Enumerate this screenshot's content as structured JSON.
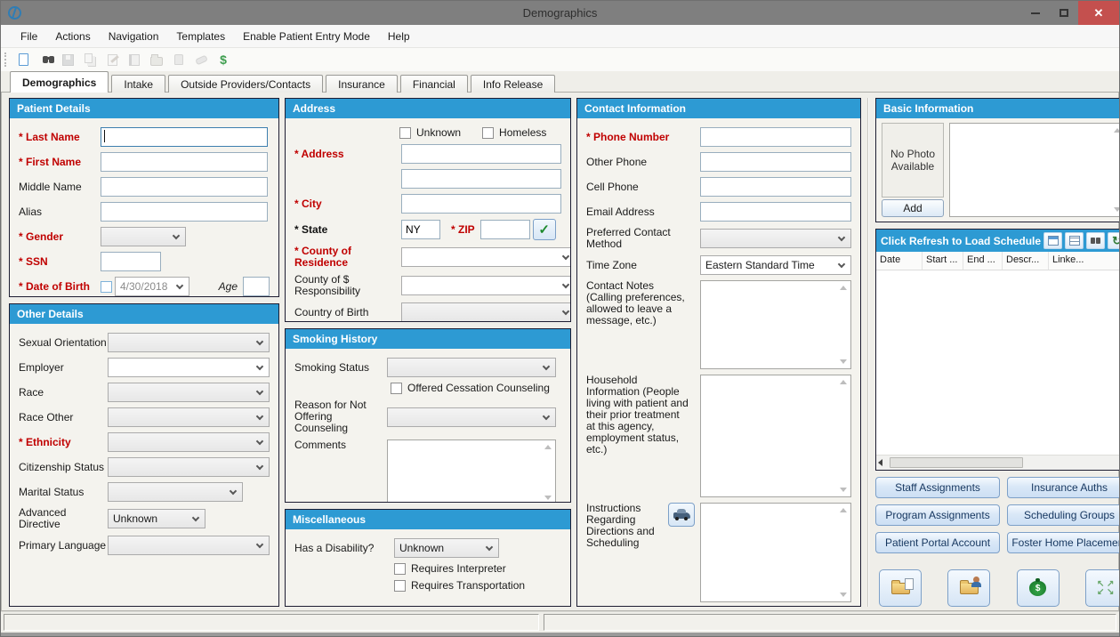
{
  "window": {
    "title": "Demographics"
  },
  "menu": {
    "items": [
      "File",
      "Actions",
      "Navigation",
      "Templates",
      "Enable Patient Entry Mode",
      "Help"
    ]
  },
  "toolbar": {
    "icons": [
      {
        "name": "new-document",
        "enabled": true
      },
      {
        "name": "find-binoculars",
        "enabled": true
      },
      {
        "name": "save",
        "enabled": false
      },
      {
        "name": "copy",
        "enabled": false
      },
      {
        "name": "edit",
        "enabled": false
      },
      {
        "name": "address-book",
        "enabled": false
      },
      {
        "name": "import-folder",
        "enabled": false
      },
      {
        "name": "package",
        "enabled": false
      },
      {
        "name": "eraser",
        "enabled": false
      },
      {
        "name": "billing-dollar",
        "enabled": true
      }
    ]
  },
  "tabs": [
    {
      "label": "Demographics",
      "active": true
    },
    {
      "label": "Intake",
      "active": false
    },
    {
      "label": "Outside Providers/Contacts",
      "active": false
    },
    {
      "label": "Insurance",
      "active": false
    },
    {
      "label": "Financial",
      "active": false
    },
    {
      "label": "Info Release",
      "active": false
    }
  ],
  "patient_details": {
    "title": "Patient Details",
    "last_name_label": "* Last Name",
    "first_name_label": "* First Name",
    "middle_name_label": "Middle Name",
    "alias_label": "Alias",
    "gender_label": "* Gender",
    "ssn_label": "* SSN",
    "dob_label": "* Date of Birth",
    "dob_value": "4/30/2018",
    "age_label": "Age"
  },
  "other_details": {
    "title": "Other Details",
    "sexual_orientation_label": "Sexual Orientation",
    "employer_label": "Employer",
    "race_label": "Race",
    "race_other_label": "Race Other",
    "ethnicity_label": "* Ethnicity",
    "citizenship_label": "Citizenship Status",
    "marital_label": "Marital Status",
    "advanced_directive_label": "Advanced Directive",
    "advanced_directive_value": "Unknown",
    "primary_language_label": "Primary Language"
  },
  "address": {
    "title": "Address",
    "unknown_label": "Unknown",
    "homeless_label": "Homeless",
    "address_label": "* Address",
    "city_label": "* City",
    "state_label": "* State",
    "state_value": "NY",
    "zip_label": "* ZIP",
    "county_residence_label": "* County of Residence",
    "county_responsibility_label": "County of $ Responsibility",
    "country_birth_label": "Country of Birth"
  },
  "smoking": {
    "title": "Smoking History",
    "status_label": "Smoking Status",
    "offered_label": "Offered Cessation Counseling",
    "reason_label": "Reason for Not Offering Counseling",
    "comments_label": "Comments"
  },
  "misc": {
    "title": "Miscellaneous",
    "disability_label": "Has a Disability?",
    "disability_value": "Unknown",
    "interpreter_label": "Requires Interpreter",
    "transportation_label": "Requires Transportation"
  },
  "contact": {
    "title": "Contact Information",
    "phone_label": "* Phone Number",
    "other_phone_label": "Other Phone",
    "cell_phone_label": "Cell Phone",
    "email_label": "Email Address",
    "preferred_method_label": "Preferred Contact Method",
    "time_zone_label": "Time Zone",
    "time_zone_value": "Eastern Standard Time",
    "notes_label": "Contact Notes (Calling preferences, allowed to leave a message, etc.)",
    "household_label": "Household Information (People living with patient and their prior treatment at this agency, employment status, etc.)",
    "instructions_label": "Instructions Regarding Directions and Scheduling"
  },
  "basic_info": {
    "title": "Basic Information",
    "no_photo_text": "No Photo Available",
    "add_label": "Add"
  },
  "schedule": {
    "title": "Click Refresh to Load Schedule",
    "header_icons": [
      "calendar",
      "list",
      "find-schedule",
      "refresh"
    ],
    "columns": [
      "Date",
      "Start ...",
      "End ...",
      "Descr...",
      "Linke..."
    ],
    "rows": []
  },
  "actions": {
    "buttons": [
      "Staff Assignments",
      "Insurance Auths",
      "Program Assignments",
      "Scheduling Groups",
      "Patient Portal Account",
      "Foster Home Placement"
    ],
    "icon_buttons": [
      "documents-folder",
      "patient-folder",
      "money-bag",
      "sync-arrows"
    ]
  },
  "colors": {
    "panel_header_blue": "#2D9AD3",
    "required_red": "#C00000",
    "close_button_red": "#C4504E",
    "titlebar_gray": "#7F7F7F",
    "button_blue_border": "#7DA0C8"
  }
}
